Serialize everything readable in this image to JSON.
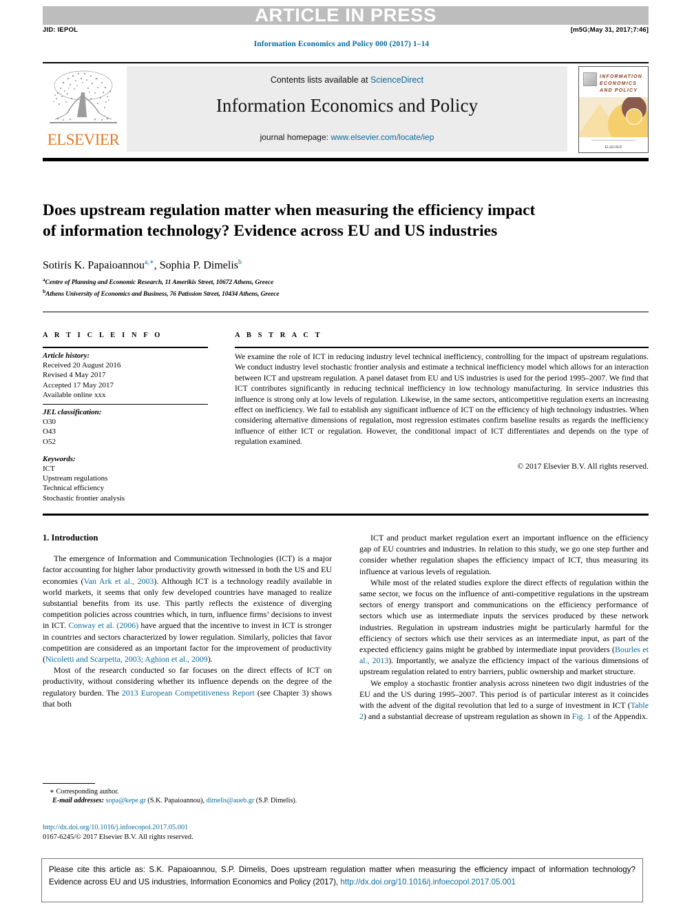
{
  "banner": {
    "article_in_press": "ARTICLE IN PRESS",
    "jid": "JID: IEPOL",
    "build_stamp": "[m5G;May 31, 2017;7:46]"
  },
  "running_head": {
    "journal_ref": "Information Economics and Policy 000 (2017) 1–14"
  },
  "masthead": {
    "contents_prefix": "Contents lists available at ",
    "contents_link": "ScienceDirect",
    "journal_name": "Information Economics and Policy",
    "homepage_prefix": "journal homepage: ",
    "homepage_link": "www.elsevier.com/locate/iep",
    "publisher_wordmark": "ELSEVIER",
    "cover": {
      "line1": "INFORMATION",
      "line2": "ECONOMICS",
      "line3": "AND POLICY",
      "footer": "ELSEVIER"
    }
  },
  "article": {
    "title": "Does upstream regulation matter when measuring the efficiency impact of information technology? Evidence across EU and US industries",
    "authors_html": "Sotiris K. Papaioannou<sup>a,∗</sup>, Sophia P. Dimelis<sup>b</sup>",
    "affiliations": [
      {
        "marker": "a",
        "text": "Centre of Planning and Economic Research, 11 Amerikis Street, 10672 Athens, Greece"
      },
      {
        "marker": "b",
        "text": "Athens University of Economics and Business, 76 Patission Street, 10434 Athens, Greece"
      }
    ]
  },
  "article_info": {
    "heading": "A R T I C L E   I N F O",
    "history_label": "Article history:",
    "history": [
      "Received 20 August 2016",
      "Revised 4 May 2017",
      "Accepted 17 May 2017",
      "Available online xxx"
    ],
    "jel_label": "JEL classification:",
    "jel_codes": [
      "O30",
      "O43",
      "O52"
    ],
    "keywords_label": "Keywords:",
    "keywords": [
      "ICT",
      "Upstream regulations",
      "Technical efficiency",
      "Stochastic frontier analysis"
    ]
  },
  "abstract": {
    "heading": "A B S T R A C T",
    "text": "We examine the role of ICT in reducing industry level technical inefficiency, controlling for the impact of upstream regulations. We conduct industry level stochastic frontier analysis and estimate a technical inefficiency model which allows for an interaction between ICT and upstream regulation. A panel dataset from EU and US industries is used for the period 1995–2007. We find that ICT contributes significantly in reducing technical inefficiency in low technology manufacturing. In service industries this influence is strong only at low levels of regulation. Likewise, in the same sectors, anticompetitive regulation exerts an increasing effect on inefficiency. We fail to establish any significant influence of ICT on the efficiency of high technology industries. When considering alternative dimensions of regulation, most regression estimates confirm baseline results as regards the inefficiency influence of either ICT or regulation. However, the conditional impact of ICT differentiates and depends on the type of regulation examined.",
    "copyright": "© 2017 Elsevier B.V. All rights reserved."
  },
  "body": {
    "section_heading": "1. Introduction",
    "left_paragraphs": [
      "The emergence of Information and Communication Technologies (ICT) is a major factor accounting for higher labor productivity growth witnessed in both the US and EU economies (<span class=\"lnk\">Van Ark et al., 2003</span>). Although ICT is a technology readily available in world markets, it seems that only few developed countries have managed to realize substantial benefits from its use. This partly reflects the existence of diverging competition policies across countries which, in turn, influence firms’ decisions to invest in ICT. <span class=\"lnk\">Conway et al. (2006)</span> have argued that the incentive to invest in ICT is stronger in countries and sectors characterized by lower regulation. Similarly, policies that favor competition are considered as an important factor for the improvement of productivity (<span class=\"lnk\">Nicoletti and Scarpetta, 2003; Aghion et al., 2009</span>).",
      "Most of the research conducted so far focuses on the direct effects of ICT on productivity, without considering whether its influence depends on the degree of the regulatory burden. The <span class=\"lnk\">2013 European Competitiveness Report</span> (see Chapter 3) shows that both"
    ],
    "right_paragraphs": [
      "ICT and product market regulation exert an important influence on the efficiency gap of EU countries and industries. In relation to this study, we go one step further and consider whether regulation shapes the efficiency impact of ICT, thus measuring its influence at various levels of regulation.",
      "While most of the related studies explore the direct effects of regulation within the same sector, we focus on the influence of anti-competitive regulations in the upstream sectors of energy transport and communications on the efficiency performance of sectors which use as intermediate inputs the services produced by these network industries. Regulation in upstream industries might be particularly harmful for the efficiency of sectors which use their services as an intermediate input, as part of the expected efficiency gains might be grabbed by intermediate input providers (<span class=\"lnk\">Bourles et al., 2013</span>). Importantly, we analyze the efficiency impact of the various dimensions of upstream regulation related to entry barriers, public ownership and market structure.",
      "We employ a stochastic frontier analysis across nineteen two digit industries of the EU and the US during 1995–2007. This period is of particular interest as it coincides with the advent of the digital revolution that led to a surge of investment in ICT (<span class=\"lnk\">Table 2</span>) and a substantial decrease of upstream regulation as shown in <span class=\"lnk\">Fig. 1</span> of the Appendix."
    ]
  },
  "footnotes": {
    "corresponding": "∗ Corresponding author.",
    "email_label": "E-mail addresses:",
    "email1": "sopa@kepe.gr",
    "email1_owner": "(S.K. Papaioannou),",
    "email2": "dimelis@aueb.gr",
    "email2_owner": "(S.P. Dimelis)."
  },
  "doi_block": {
    "doi_url": "http://dx.doi.org/10.1016/j.infoecopol.2017.05.001",
    "issn_line": "0167-6245/© 2017 Elsevier B.V. All rights reserved."
  },
  "citation_footer": {
    "text": "Please cite this article as: S.K. Papaioannou, S.P. Dimelis, Does upstream regulation matter when measuring the efficiency impact of information technology? Evidence across EU and US industries, Information Economics and Policy (2017),",
    "doi": "http://dx.doi.org/10.1016/j.infoecopol.2017.05.001"
  },
  "colors": {
    "link_blue": "#0a6a9a",
    "elsevier_orange": "#E87722",
    "banner_gray": "#bdbdbd",
    "masthead_gray": "#ececec"
  }
}
